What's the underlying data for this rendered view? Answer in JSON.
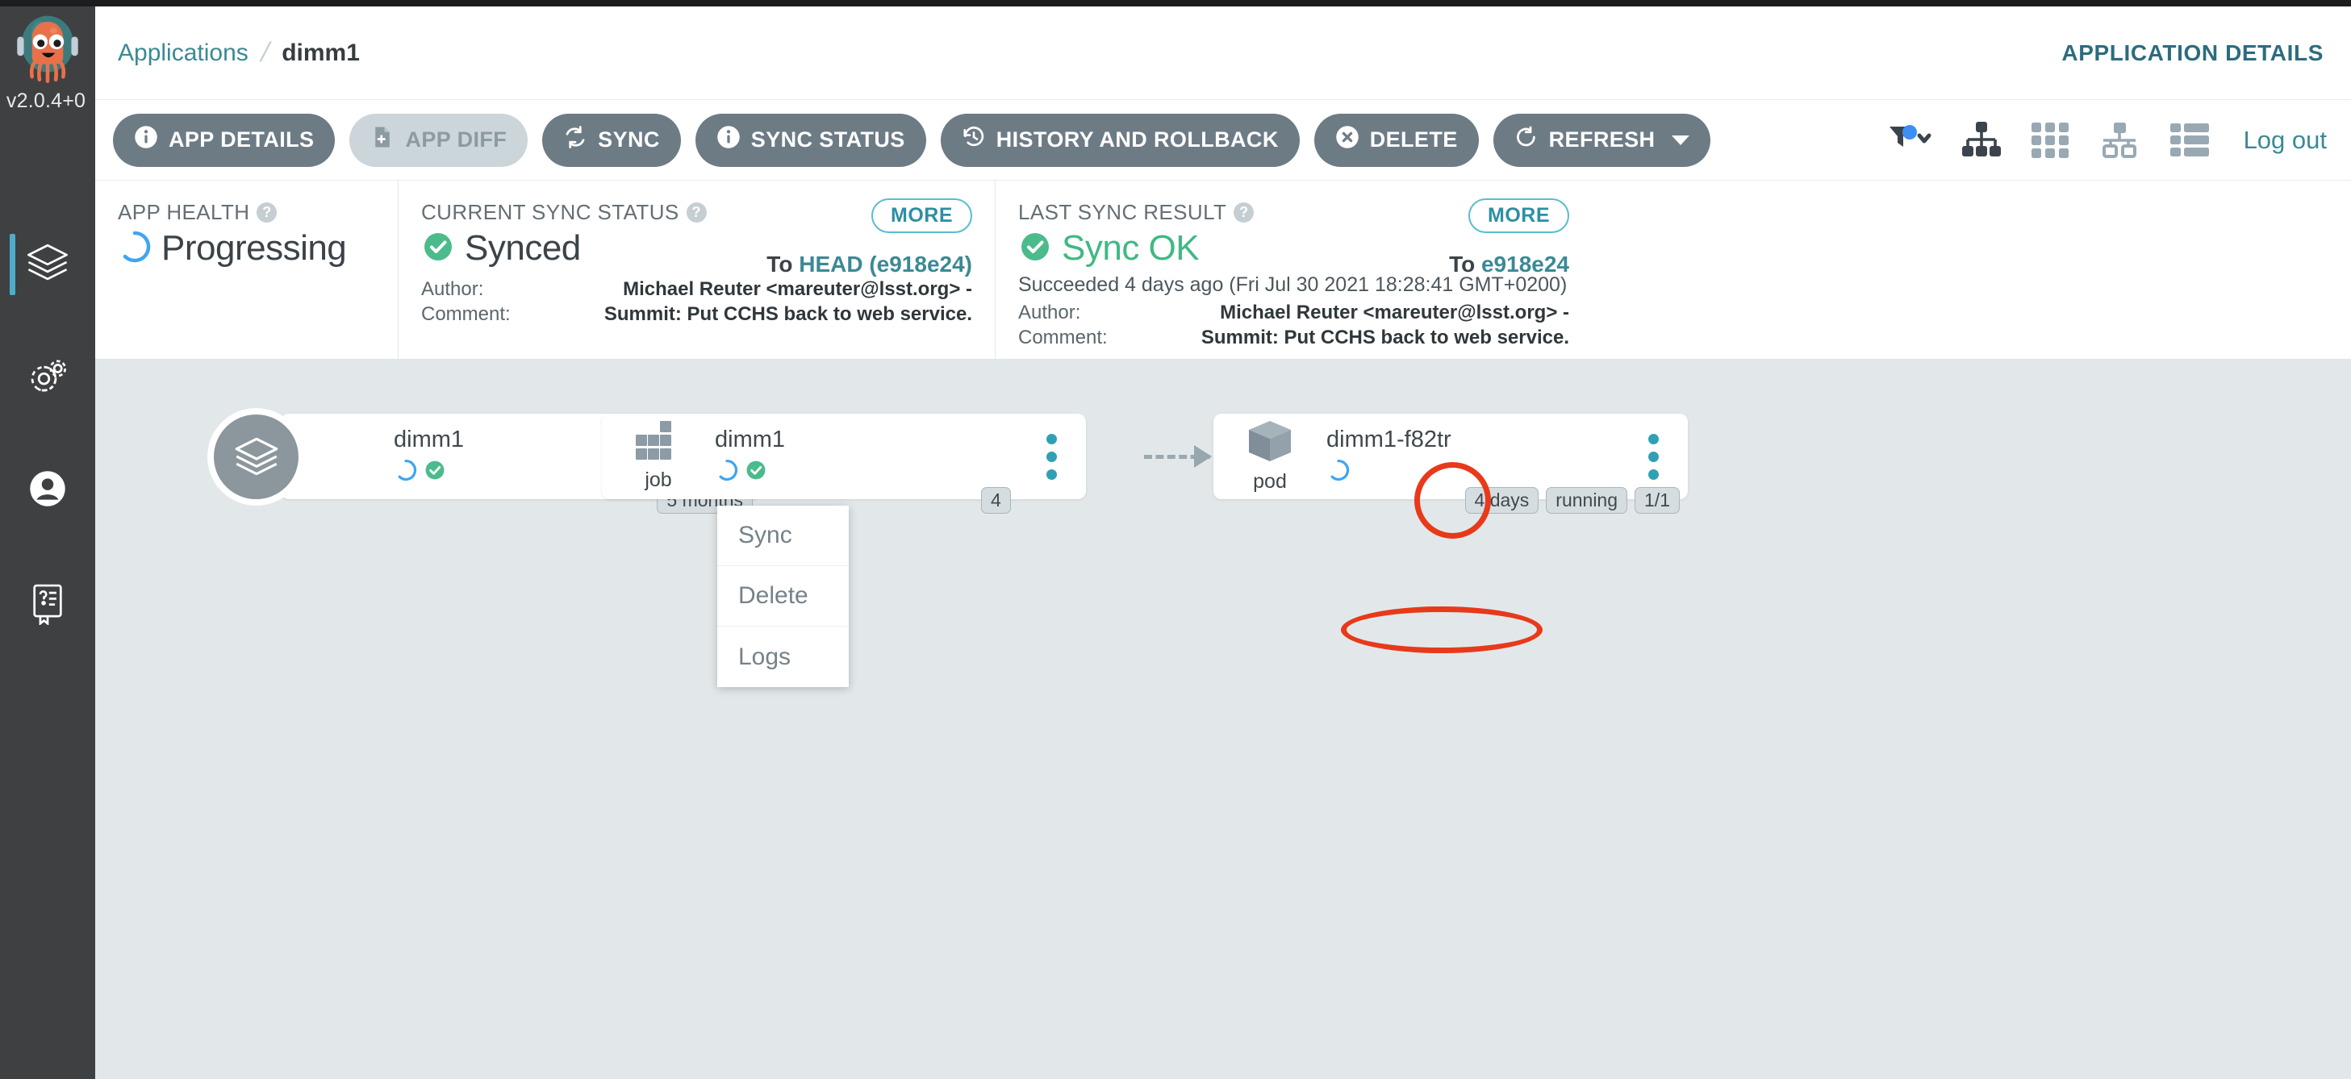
{
  "brand": {
    "logo_icon": "argo-octopus-logo",
    "version": "v2.0.4+0"
  },
  "sidebar": {
    "items": [
      {
        "id": "applications",
        "icon": "layers-icon",
        "label": "Applications",
        "active": true
      },
      {
        "id": "settings",
        "icon": "gears-icon",
        "label": "Settings",
        "active": false
      },
      {
        "id": "user-info",
        "icon": "user-circle-icon",
        "label": "User Info",
        "active": false
      },
      {
        "id": "documentation",
        "icon": "book-question-icon",
        "label": "Documentation",
        "active": false
      }
    ]
  },
  "header": {
    "breadcrumb": {
      "root": "Applications",
      "separator": "/",
      "current": "dimm1"
    },
    "page_kind": "APPLICATION DETAILS"
  },
  "toolbar": {
    "buttons": [
      {
        "id": "app-details",
        "label": "APP DETAILS",
        "icon": "info-circle-icon",
        "disabled": false,
        "caret": false
      },
      {
        "id": "app-diff",
        "label": "APP DIFF",
        "icon": "file-diff-icon",
        "disabled": true,
        "caret": false
      },
      {
        "id": "sync",
        "label": "SYNC",
        "icon": "sync-arrows-icon",
        "disabled": false,
        "caret": false
      },
      {
        "id": "sync-status",
        "label": "SYNC STATUS",
        "icon": "info-circle-icon",
        "disabled": false,
        "caret": false
      },
      {
        "id": "history-and-rollback",
        "label": "HISTORY AND ROLLBACK",
        "icon": "history-clock-icon",
        "disabled": false,
        "caret": false
      },
      {
        "id": "delete",
        "label": "DELETE",
        "icon": "x-circle-icon",
        "disabled": false,
        "caret": false
      },
      {
        "id": "refresh",
        "label": "REFRESH",
        "icon": "refresh-icon",
        "disabled": false,
        "caret": true
      }
    ],
    "view_icons": [
      {
        "id": "filter",
        "icon": "filter-icon",
        "badge": true,
        "chevron": true,
        "active": false
      },
      {
        "id": "tree-view",
        "icon": "sitemap-icon",
        "active": true
      },
      {
        "id": "pods-view",
        "icon": "grid-icon",
        "active": false
      },
      {
        "id": "network-view",
        "icon": "network-icon",
        "active": false
      },
      {
        "id": "list-view",
        "icon": "list-icon",
        "active": false
      }
    ],
    "logout_label": "Log out"
  },
  "status": {
    "health": {
      "title": "APP HEALTH",
      "help_icon": "question-circle-icon",
      "state": "Progressing",
      "state_icon": "progressing-spinner-icon"
    },
    "sync": {
      "title": "CURRENT SYNC STATUS",
      "help_icon": "question-circle-icon",
      "state": "Synced",
      "state_icon": "check-circle-icon",
      "more_label": "MORE",
      "to_prefix": "To",
      "to_target": "HEAD (e918e24)",
      "author_key": "Author:",
      "author_value": "Michael Reuter <mareuter@lsst.org> -",
      "comment_key": "Comment:",
      "comment_value": "Summit: Put CCHS back to web service."
    },
    "result": {
      "title": "LAST SYNC RESULT",
      "help_icon": "question-circle-icon",
      "state": "Sync OK",
      "state_icon": "check-circle-icon",
      "more_label": "MORE",
      "to_prefix": "To",
      "to_target": "e918e24",
      "succeeded": "Succeeded 4 days ago (Fri Jul 30 2021 18:28:41 GMT+0200)",
      "author_key": "Author:",
      "author_value": "Michael Reuter <mareuter@lsst.org> -",
      "comment_key": "Comment:",
      "comment_value": "Summit: Put CCHS back to web service."
    }
  },
  "tree": {
    "nodes": [
      {
        "id": "app-dimm1",
        "name": "dimm1",
        "kind": "",
        "kind_icon": "layers-icon",
        "health_icons": [
          "progressing-spinner-icon",
          "synced-check-icon"
        ],
        "tags": [
          "5 months"
        ],
        "kebab_icon": "kebab-menu-icon"
      },
      {
        "id": "job-dimm1",
        "name": "dimm1",
        "kind": "job",
        "kind_icon": "job-grid-icon",
        "health_icons": [
          "progressing-spinner-icon",
          "synced-check-icon"
        ],
        "tags": [
          "4"
        ],
        "kebab_icon": "kebab-menu-icon"
      },
      {
        "id": "pod-dimm1-f82tr",
        "name": "dimm1-f82tr",
        "kind": "pod",
        "kind_icon": "cube-icon",
        "health_icons": [
          "progressing-spinner-icon"
        ],
        "tags": [
          "4 days",
          "running",
          "1/1"
        ],
        "kebab_icon": "kebab-menu-icon"
      }
    ]
  },
  "context_menu": {
    "items": [
      {
        "id": "sync",
        "label": "Sync"
      },
      {
        "id": "delete",
        "label": "Delete"
      },
      {
        "id": "logs",
        "label": "Logs"
      }
    ]
  },
  "annotations": [
    {
      "id": "highlight-job-kebab",
      "shape": "ellipse",
      "color": "#e8391b"
    },
    {
      "id": "highlight-menu-delete",
      "shape": "ellipse",
      "color": "#e8391b"
    }
  ],
  "colors": {
    "accent_teal": "#3b8995",
    "sidebar_bg": "#3f4042",
    "canvas_bg": "#e2e8ea",
    "button_gray": "#6d7b85",
    "healthy_green": "#41b883",
    "progressing_blue": "#3fa5f0",
    "annotation_red": "#e8391b"
  }
}
